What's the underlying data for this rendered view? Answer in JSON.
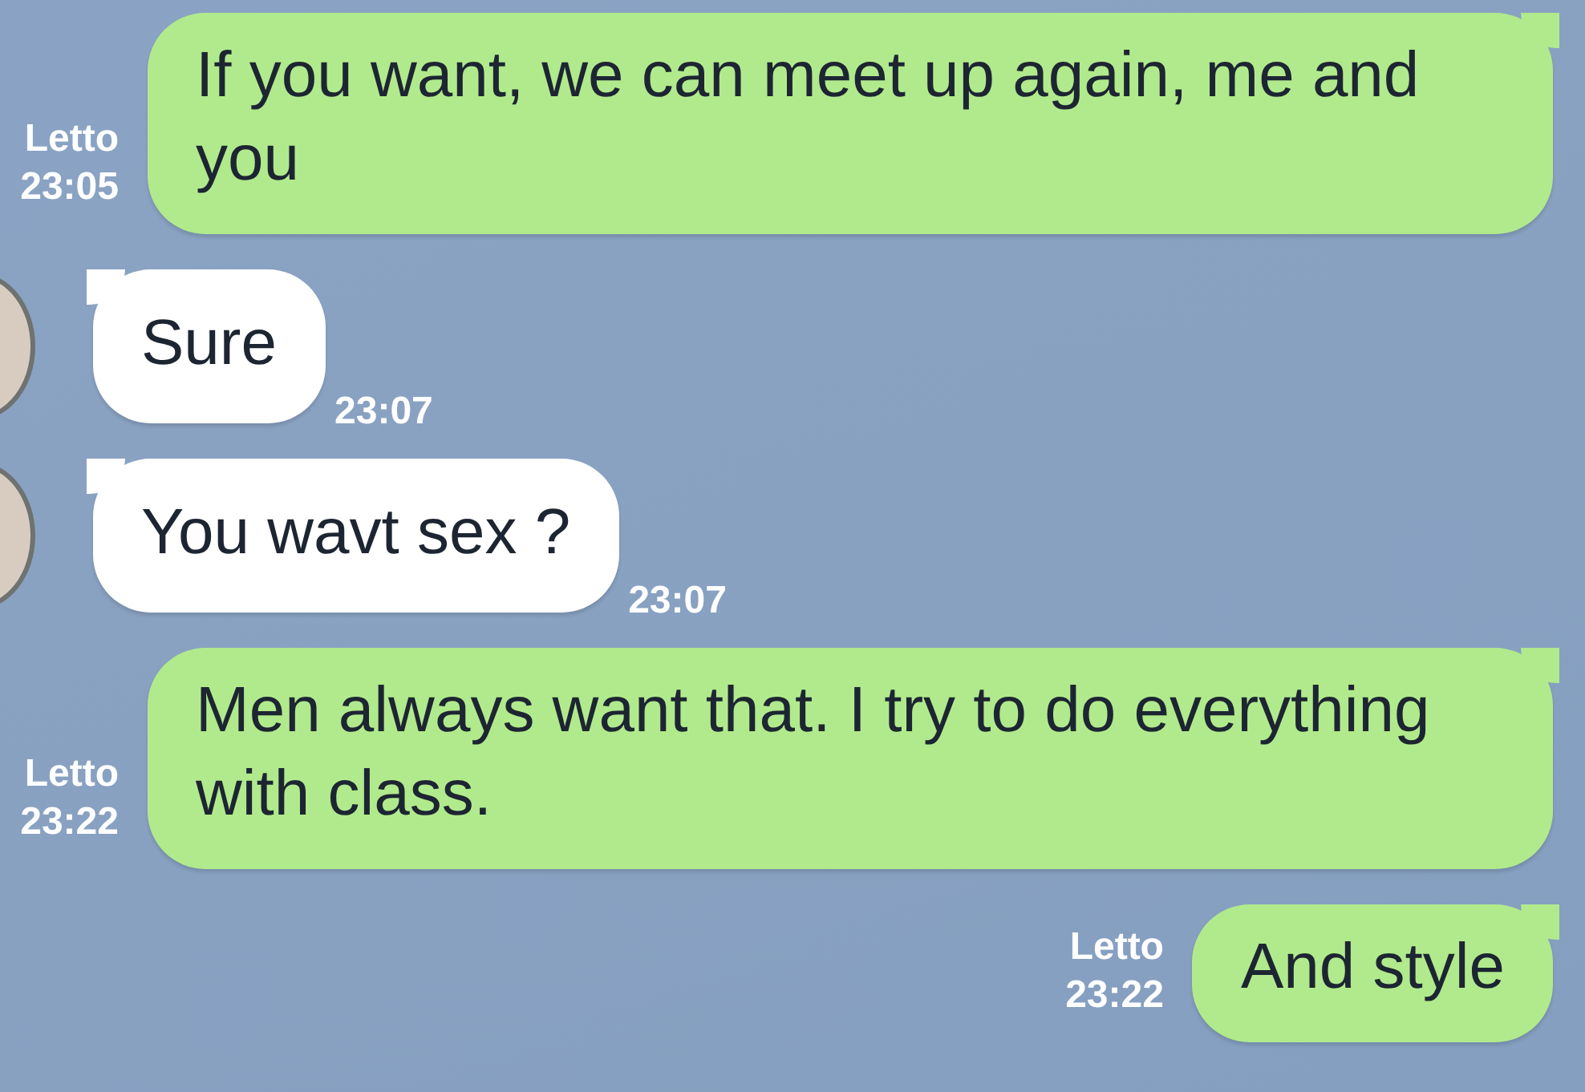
{
  "messages": [
    {
      "kind": "sent",
      "status": "Letto",
      "time": "23:05",
      "text": "If you want, we can meet up again, me and you"
    },
    {
      "kind": "received",
      "text": "Sure",
      "time": "23:07"
    },
    {
      "kind": "received",
      "text": "You wavt sex ?",
      "time": "23:07"
    },
    {
      "kind": "sent",
      "status": "Letto",
      "time": "23:22",
      "text": "Men always want that. I try to do everything with class."
    },
    {
      "kind": "sent",
      "status": "Letto",
      "time": "23:22",
      "text": "And style"
    }
  ]
}
